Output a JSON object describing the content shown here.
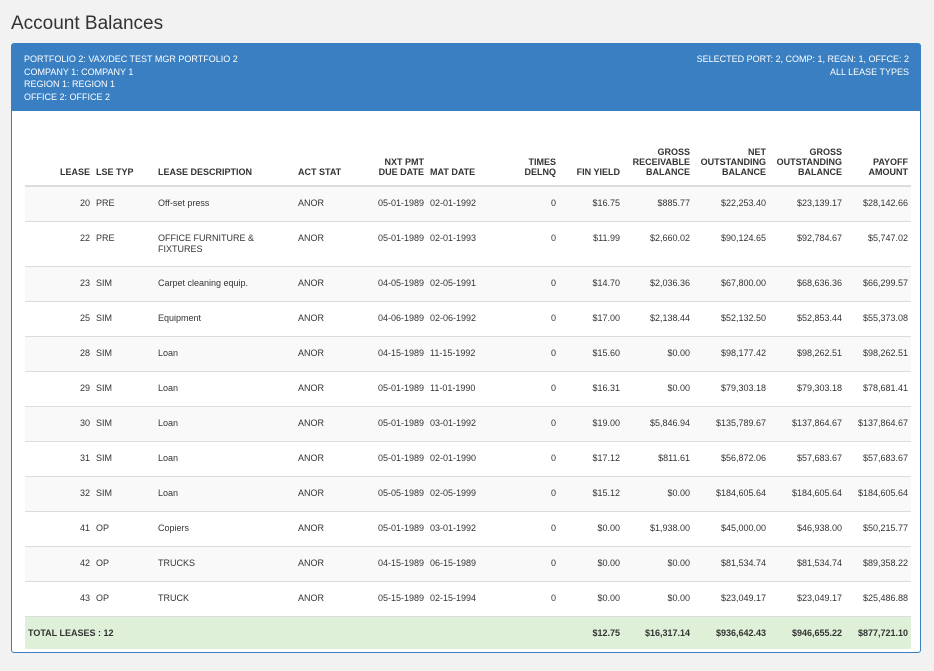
{
  "page": {
    "title": "Account Balances"
  },
  "header": {
    "left": [
      "PORTFOLIO  2:  VAX/DEC TEST MGR PORTFOLIO 2",
      "COMPANY  1:  COMPANY 1",
      "REGION  1:  REGION 1",
      "OFFICE  2:  OFFICE 2"
    ],
    "right": [
      "SELECTED PORT: 2, COMP: 1, REGN: 1, OFFCE: 2",
      "ALL LEASE TYPES"
    ]
  },
  "table": {
    "columns": {
      "lease": "LEASE",
      "lse_typ": "LSE TYP",
      "lease_description": "LEASE DESCRIPTION",
      "act_stat": "ACT STAT",
      "nxt_pmt_1": "NXT PMT",
      "nxt_pmt_2": "DUE DATE",
      "mat_date": "MAT DATE",
      "times_1": "TIMES",
      "times_2": "DELNQ",
      "fin_yield": "FIN YIELD",
      "gross_rec_1": "GROSS",
      "gross_rec_2": "RECEIVABLE",
      "gross_rec_3": "BALANCE",
      "net_out_1": "NET",
      "net_out_2": "OUTSTANDING",
      "net_out_3": "BALANCE",
      "gross_out_1": "GROSS",
      "gross_out_2": "OUTSTANDING",
      "gross_out_3": "BALANCE",
      "payoff_1": "PAYOFF",
      "payoff_2": "AMOUNT"
    },
    "rows": [
      {
        "lease": "20",
        "typ": "PRE",
        "desc": "Off-set press",
        "desc2": "",
        "stat": "ANOR",
        "due": "05-01-1989",
        "mat": "02-01-1992",
        "delnq": "0",
        "yield": "$16.75",
        "grb": "$885.77",
        "nob": "$22,253.40",
        "gob": "$23,139.17",
        "payoff": "$28,142.66"
      },
      {
        "lease": "22",
        "typ": "PRE",
        "desc": "OFFICE FURNITURE &",
        "desc2": "FIXTURES",
        "stat": "ANOR",
        "due": "05-01-1989",
        "mat": "02-01-1993",
        "delnq": "0",
        "yield": "$11.99",
        "grb": "$2,660.02",
        "nob": "$90,124.65",
        "gob": "$92,784.67",
        "payoff": "$5,747.02"
      },
      {
        "lease": "23",
        "typ": "SIM",
        "desc": "Carpet cleaning equip.",
        "desc2": "",
        "stat": "ANOR",
        "due": "04-05-1989",
        "mat": "02-05-1991",
        "delnq": "0",
        "yield": "$14.70",
        "grb": "$2,036.36",
        "nob": "$67,800.00",
        "gob": "$68,636.36",
        "payoff": "$66,299.57"
      },
      {
        "lease": "25",
        "typ": "SIM",
        "desc": "Equipment",
        "desc2": "",
        "stat": "ANOR",
        "due": "04-06-1989",
        "mat": "02-06-1992",
        "delnq": "0",
        "yield": "$17.00",
        "grb": "$2,138.44",
        "nob": "$52,132.50",
        "gob": "$52,853.44",
        "payoff": "$55,373.08"
      },
      {
        "lease": "28",
        "typ": "SIM",
        "desc": "Loan",
        "desc2": "",
        "stat": "ANOR",
        "due": "04-15-1989",
        "mat": "11-15-1992",
        "delnq": "0",
        "yield": "$15.60",
        "grb": "$0.00",
        "nob": "$98,177.42",
        "gob": "$98,262.51",
        "payoff": "$98,262.51"
      },
      {
        "lease": "29",
        "typ": "SIM",
        "desc": "Loan",
        "desc2": "",
        "stat": "ANOR",
        "due": "05-01-1989",
        "mat": "11-01-1990",
        "delnq": "0",
        "yield": "$16.31",
        "grb": "$0.00",
        "nob": "$79,303.18",
        "gob": "$79,303.18",
        "payoff": "$78,681.41"
      },
      {
        "lease": "30",
        "typ": "SIM",
        "desc": "Loan",
        "desc2": "",
        "stat": "ANOR",
        "due": "05-01-1989",
        "mat": "03-01-1992",
        "delnq": "0",
        "yield": "$19.00",
        "grb": "$5,846.94",
        "nob": "$135,789.67",
        "gob": "$137,864.67",
        "payoff": "$137,864.67"
      },
      {
        "lease": "31",
        "typ": "SIM",
        "desc": "Loan",
        "desc2": "",
        "stat": "ANOR",
        "due": "05-01-1989",
        "mat": "02-01-1990",
        "delnq": "0",
        "yield": "$17.12",
        "grb": "$811.61",
        "nob": "$56,872.06",
        "gob": "$57,683.67",
        "payoff": "$57,683.67"
      },
      {
        "lease": "32",
        "typ": "SIM",
        "desc": "Loan",
        "desc2": "",
        "stat": "ANOR",
        "due": "05-05-1989",
        "mat": "02-05-1999",
        "delnq": "0",
        "yield": "$15.12",
        "grb": "$0.00",
        "nob": "$184,605.64",
        "gob": "$184,605.64",
        "payoff": "$184,605.64"
      },
      {
        "lease": "41",
        "typ": "OP",
        "desc": "Copiers",
        "desc2": "",
        "stat": "ANOR",
        "due": "05-01-1989",
        "mat": "03-01-1992",
        "delnq": "0",
        "yield": "$0.00",
        "grb": "$1,938.00",
        "nob": "$45,000.00",
        "gob": "$46,938.00",
        "payoff": "$50,215.77"
      },
      {
        "lease": "42",
        "typ": "OP",
        "desc": "TRUCKS",
        "desc2": "",
        "stat": "ANOR",
        "due": "04-15-1989",
        "mat": "06-15-1989",
        "delnq": "0",
        "yield": "$0.00",
        "grb": "$0.00",
        "nob": "$81,534.74",
        "gob": "$81,534.74",
        "payoff": "$89,358.22"
      },
      {
        "lease": "43",
        "typ": "OP",
        "desc": "TRUCK",
        "desc2": "",
        "stat": "ANOR",
        "due": "05-15-1989",
        "mat": "02-15-1994",
        "delnq": "0",
        "yield": "$0.00",
        "grb": "$0.00",
        "nob": "$23,049.17",
        "gob": "$23,049.17",
        "payoff": "$25,486.88"
      }
    ],
    "total": {
      "label": "TOTAL LEASES : 12",
      "yield": "$12.75",
      "grb": "$16,317.14",
      "nob": "$936,642.43",
      "gob": "$946,655.22",
      "payoff": "$877,721.10"
    }
  }
}
